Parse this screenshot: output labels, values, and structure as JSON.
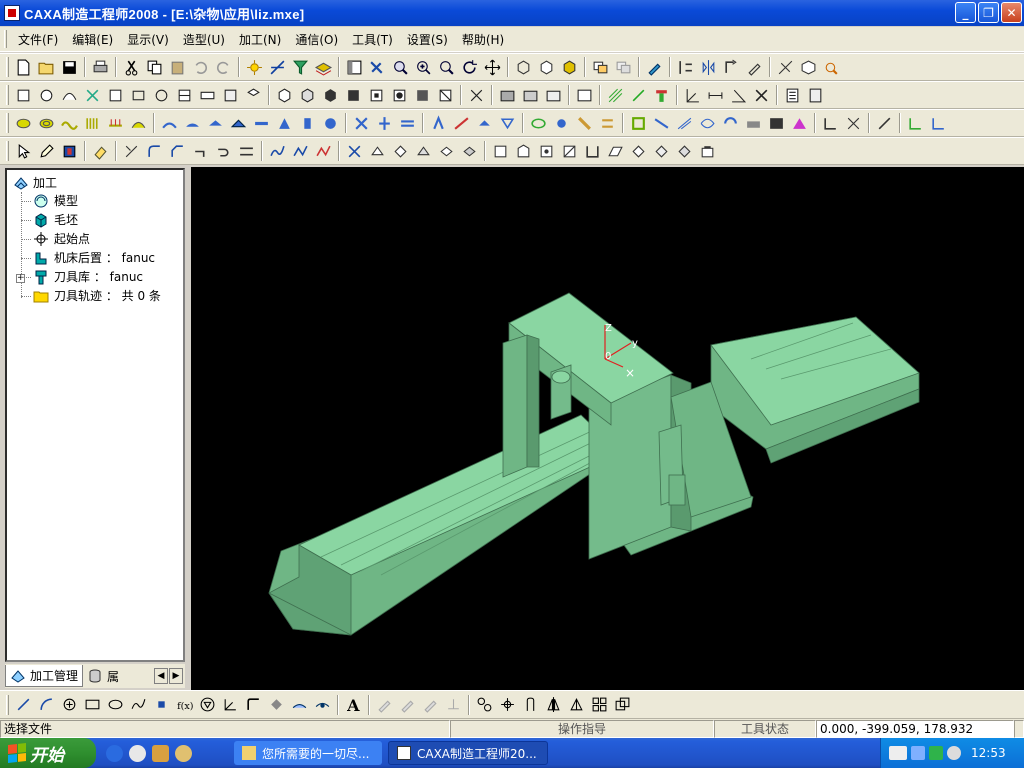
{
  "window": {
    "title": "CAXA制造工程师2008  - [E:\\杂物\\应用\\liz.mxe]",
    "min_label": "_",
    "max_label": "❐",
    "close_label": "✕"
  },
  "menu": {
    "items": [
      "文件(F)",
      "编辑(E)",
      "显示(V)",
      "造型(U)",
      "加工(N)",
      "通信(O)",
      "工具(T)",
      "设置(S)",
      "帮助(H)"
    ]
  },
  "tree": {
    "root": "加工",
    "nodes": [
      {
        "label": "模型",
        "icon": "model-icon"
      },
      {
        "label": "毛坯",
        "icon": "blank-icon"
      },
      {
        "label": "起始点",
        "icon": "start-point-icon"
      },
      {
        "label": "机床后置 ： fanuc",
        "icon": "machine-post-icon"
      },
      {
        "label": "刀具库 ： fanuc",
        "icon": "tool-library-icon"
      },
      {
        "label": "刀具轨迹 ： 共 0 条",
        "icon": "folder-icon"
      }
    ],
    "expander": "+"
  },
  "panel_tabs": {
    "active": "加工管理",
    "second": "属"
  },
  "viewport": {
    "axis_z": "Z",
    "axis_y": "y",
    "axis_origin": "0",
    "marker": "×",
    "model_color": "#7fcf99",
    "background": "#000000"
  },
  "statusbar": {
    "prompt": "选择文件",
    "operation_hint": "操作指导",
    "tool_state": "工具状态",
    "coords": "0.000, -399.059, 178.932"
  },
  "taskbar": {
    "start": "开始",
    "tasks": [
      "您所需要的一切尽...",
      "CAXA制造工程师20..."
    ],
    "clock": "12:53"
  },
  "colors": {
    "titlebar": "#0a4ad8",
    "chrome": "#ece9d8",
    "taskbar": "#245edb",
    "start_green": "#2f8f2f"
  }
}
